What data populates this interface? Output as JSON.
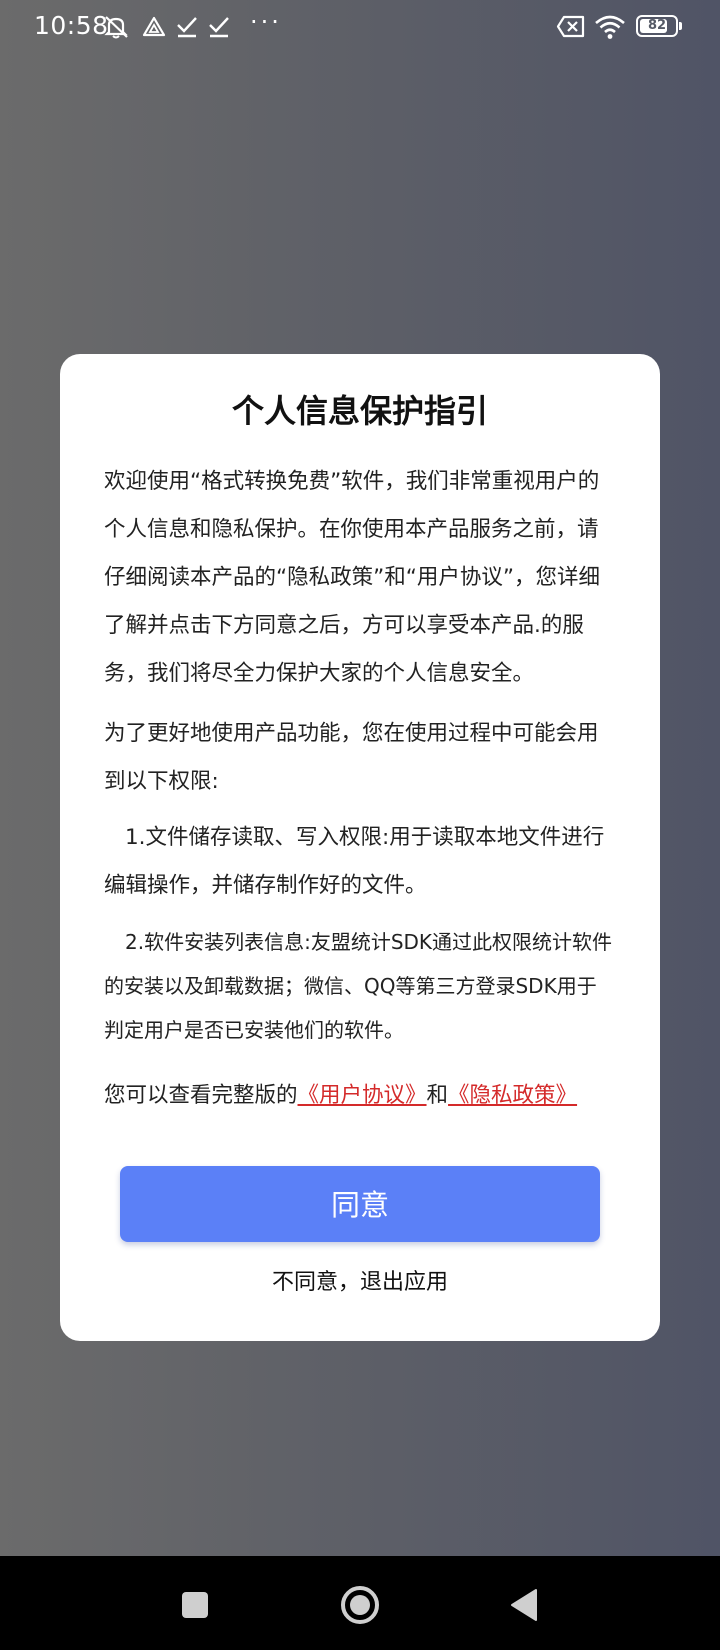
{
  "status_bar": {
    "time": "10:58",
    "battery_level": "82",
    "battery_fraction": 0.82,
    "icons": [
      "mute-alarm-icon",
      "drive-icon",
      "check-icon",
      "check-icon",
      "more-dots-icon",
      "no-sim-icon",
      "wifi-icon",
      "battery-icon"
    ],
    "more": "···"
  },
  "dialog": {
    "title": "个人信息保护指引",
    "intro": "欢迎使用“格式转换免费”软件，我们非常重视用户的个人信息和隐私保护。在你使用本产品服务之前，请仔细阅读本产品的“隐私政策”和“用户协议”，您详细了解并点击下方同意之后，方可以享受本产品.的服务，我们将尽全力保护大家的个人信息安全。",
    "permissions_intro": "为了更好地使用产品功能，您在使用过程中可能会用到以下权限:",
    "item1": "1.文件储存读取、写入权限:用于读取本地文件进行编辑操作，并储存制作好的文件。",
    "item2": "2.软件安装列表信息:友盟统计SDK通过此权限统计软件的安装以及卸载数据；微信、QQ等第三方登录SDK用于判定用户是否已安装他们的软件。",
    "links_prefix": "您可以查看完整版的",
    "user_agreement_link": "《用户协议》",
    "links_and": "和",
    "privacy_policy_link": "《隐私政策》",
    "agree_label": "同意",
    "disagree_label": "不同意，退出应用"
  },
  "colors": {
    "agree_button": "#5b80f7",
    "link": "#d42a2a",
    "nav_bar": "#000000"
  },
  "nav_bar": {
    "icons": [
      "recents-square-icon",
      "home-circle-icon",
      "back-triangle-icon"
    ]
  }
}
